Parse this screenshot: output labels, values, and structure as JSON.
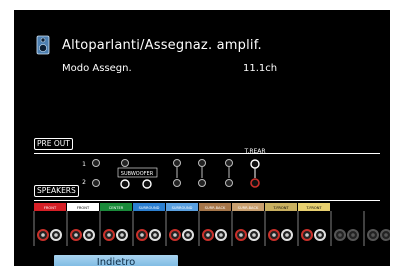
{
  "header": {
    "title": "Altoparlanti/Assegnaz. amplif.",
    "icon": "speaker-icon"
  },
  "mode": {
    "label": "Modo Assegn.",
    "value": "11.1ch"
  },
  "preout": {
    "label": "PRE OUT",
    "subwoofer_label": "SUBWOOFER",
    "trear_label": "T.REAR",
    "sub_marks": [
      "1",
      "2"
    ]
  },
  "speakers": {
    "label": "SPEAKERS",
    "channels": [
      {
        "label": "FRONT",
        "color": "#d61f26"
      },
      {
        "label": "FRONT",
        "color": "#ffffff"
      },
      {
        "label": "CENTER",
        "color": "#1a8a3a"
      },
      {
        "label": "SURROUND",
        "color": "#2c7fd0"
      },
      {
        "label": "SURROUND",
        "color": "#5aa0e0"
      },
      {
        "label": "SURR.BACK",
        "color": "#a6764a"
      },
      {
        "label": "SURR.BACK",
        "color": "#c9a070"
      },
      {
        "label": "T.FRONT",
        "color": "#c9b060"
      },
      {
        "label": "T.FRONT",
        "color": "#e8d070"
      }
    ]
  },
  "footer": {
    "back_label": "Indietro"
  },
  "colors": {
    "background": "#000000",
    "back_button": "#8cc4ea",
    "active_terminal": "#c8302a"
  }
}
